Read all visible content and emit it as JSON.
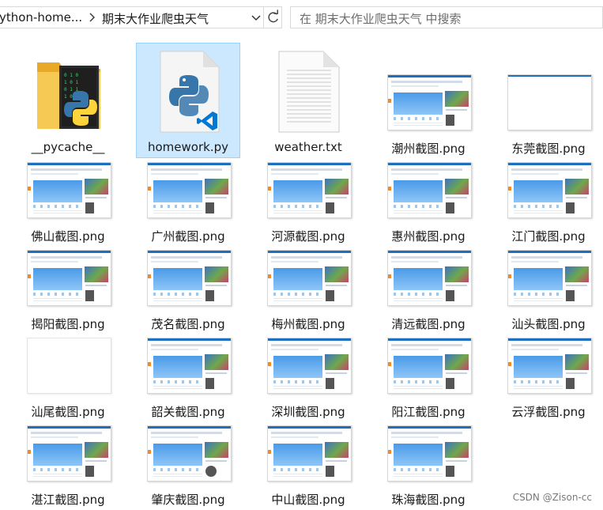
{
  "address": {
    "parent_folder": "ython-home...",
    "current_folder": "期末大作业爬虫天气",
    "search_placeholder": "在 期末大作业爬虫天气 中搜索"
  },
  "files": [
    {
      "name": "__pycache__",
      "kind": "folder"
    },
    {
      "name": "homework.py",
      "kind": "python",
      "selected": true
    },
    {
      "name": "weather.txt",
      "kind": "text"
    },
    {
      "name": "潮州截图.png",
      "kind": "image"
    },
    {
      "name": "东莞截图.png",
      "kind": "image-blank"
    },
    {
      "name": "佛山截图.png",
      "kind": "image"
    },
    {
      "name": "广州截图.png",
      "kind": "image"
    },
    {
      "name": "河源截图.png",
      "kind": "image"
    },
    {
      "name": "惠州截图.png",
      "kind": "image"
    },
    {
      "name": "江门截图.png",
      "kind": "image"
    },
    {
      "name": "揭阳截图.png",
      "kind": "image"
    },
    {
      "name": "茂名截图.png",
      "kind": "image"
    },
    {
      "name": "梅州截图.png",
      "kind": "image"
    },
    {
      "name": "清远截图.png",
      "kind": "image"
    },
    {
      "name": "汕头截图.png",
      "kind": "image"
    },
    {
      "name": "汕尾截图.png",
      "kind": "image-empty"
    },
    {
      "name": "韶关截图.png",
      "kind": "image"
    },
    {
      "name": "深圳截图.png",
      "kind": "image"
    },
    {
      "name": "阳江截图.png",
      "kind": "image"
    },
    {
      "name": "云浮截图.png",
      "kind": "image"
    },
    {
      "name": "湛江截图.png",
      "kind": "image"
    },
    {
      "name": "肇庆截图.png",
      "kind": "image-round"
    },
    {
      "name": "中山截图.png",
      "kind": "image"
    },
    {
      "name": "珠海截图.png",
      "kind": "image"
    }
  ],
  "watermark": "CSDN @Zison-cc",
  "colors": {
    "selection_bg": "#cce8ff",
    "selection_border": "#99d1ff",
    "folder": "#f3c44e",
    "python_blue": "#3776ab",
    "python_yellow": "#ffd43b",
    "vscode_blue": "#0078d4"
  },
  "icons": {
    "breadcrumb_separator": "chevron-right-icon",
    "dropdown": "chevron-down-icon",
    "refresh": "refresh-icon"
  }
}
